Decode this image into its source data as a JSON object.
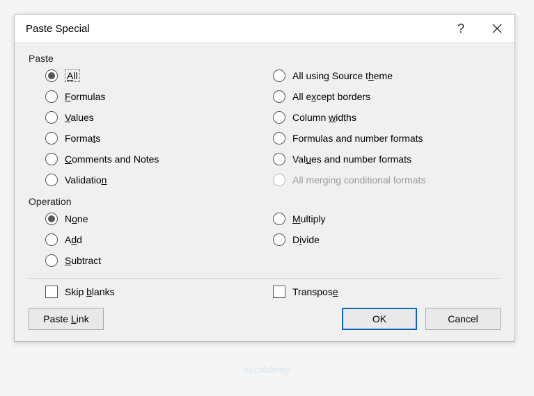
{
  "title": "Paste Special",
  "sections": {
    "paste": {
      "label": "Paste",
      "options_left": [
        {
          "key": "all",
          "html": "<u>A</u>ll",
          "selected": true,
          "focused": true
        },
        {
          "key": "formulas",
          "html": "<u>F</u>ormulas"
        },
        {
          "key": "values",
          "html": "<u>V</u>alues"
        },
        {
          "key": "formats",
          "html": "Forma<u>t</u>s"
        },
        {
          "key": "comments",
          "html": "<u>C</u>omments and Notes"
        },
        {
          "key": "validation",
          "html": "Validatio<u>n</u>"
        }
      ],
      "options_right": [
        {
          "key": "all-source-theme",
          "html": "All using Source t<u>h</u>eme"
        },
        {
          "key": "all-except-borders",
          "html": "All e<u>x</u>cept borders"
        },
        {
          "key": "column-widths",
          "html": "Column <u>w</u>idths"
        },
        {
          "key": "formulas-number",
          "html": "Formulas and number formats"
        },
        {
          "key": "values-number",
          "html": "Val<u>u</u>es and number formats"
        },
        {
          "key": "merging-conditional",
          "html": "All mer<u>g</u>ing conditional formats",
          "disabled": true
        }
      ]
    },
    "operation": {
      "label": "Operation",
      "options_left": [
        {
          "key": "none",
          "html": "N<u>o</u>ne",
          "selected": true
        },
        {
          "key": "add",
          "html": "A<u>d</u>d"
        },
        {
          "key": "subtract",
          "html": "<u>S</u>ubtract"
        }
      ],
      "options_right": [
        {
          "key": "multiply",
          "html": "<u>M</u>ultiply"
        },
        {
          "key": "divide",
          "html": "D<u>i</u>vide"
        }
      ]
    }
  },
  "checks": {
    "skip_blanks": "Skip <u>b</u>lanks",
    "transpose": "Transpos<u>e</u>"
  },
  "buttons": {
    "paste_link": "Paste <u>L</u>ink",
    "ok": "OK",
    "cancel": "Cancel"
  },
  "watermark": "exceldemy"
}
